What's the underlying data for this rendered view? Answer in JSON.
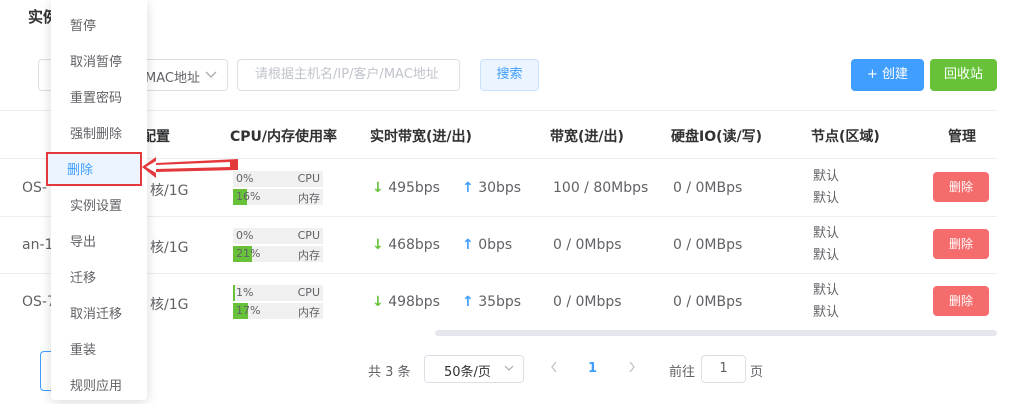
{
  "page": {
    "title_fragment": "实例"
  },
  "filters": {
    "mac_select": "MAC地址",
    "search_placeholder": "请根据主机名/IP/客户/MAC地址",
    "search_button": "搜索"
  },
  "actions": {
    "create": "创建",
    "create_icon": "+",
    "recycle_bin": "回收站"
  },
  "table": {
    "headers": {
      "config": "配置",
      "cpu_mem": "CPU/内存使用率",
      "realtime_bw": "实时带宽(进/出)",
      "bandwidth": "带宽(进/出)",
      "disk_io": "硬盘IO(读/写)",
      "node": "节点(区域)",
      "manage": "管理"
    },
    "rows": [
      {
        "name_fragment": "OS-",
        "config": "核/1G",
        "cpu_pct": "0%",
        "cpu_value": 0,
        "mem_pct": "16%",
        "mem_value": 16,
        "cpu_label": "CPU",
        "mem_label": "内存",
        "in": "495bps",
        "out": "30bps",
        "bandwidth": "100 / 80Mbps",
        "disk_io": "0 / 0MBps",
        "node1": "默认",
        "node2": "默认",
        "delete": "删除"
      },
      {
        "name_fragment": "an-1",
        "config": "核/1G",
        "cpu_pct": "0%",
        "cpu_value": 0,
        "mem_pct": "21%",
        "mem_value": 21,
        "cpu_label": "CPU",
        "mem_label": "内存",
        "in": "468bps",
        "out": "0bps",
        "bandwidth": "0 / 0Mbps",
        "disk_io": "0 / 0MBps",
        "node1": "默认",
        "node2": "默认",
        "delete": "删除"
      },
      {
        "name_fragment": "OS-7",
        "config": "核/1G",
        "cpu_pct": "1%",
        "cpu_value": 1,
        "mem_pct": "17%",
        "mem_value": 17,
        "cpu_label": "CPU",
        "mem_label": "内存",
        "in": "498bps",
        "out": "35bps",
        "bandwidth": "0 / 0Mbps",
        "disk_io": "0 / 0MBps",
        "node1": "默认",
        "node2": "默认",
        "delete": "删除"
      }
    ]
  },
  "pagination": {
    "total": "共 3 条",
    "page_size": "50条/页",
    "current_page": "1",
    "goto_label": "前往",
    "goto_value": "1",
    "page_suffix": "页"
  },
  "dropdown_menu": {
    "items": [
      "暂停",
      "取消暂停",
      "重置密码",
      "强制删除",
      "删除",
      "实例设置",
      "导出",
      "迁移",
      "取消迁移",
      "重装",
      "规则应用"
    ],
    "active_index": 4
  },
  "colors": {
    "primary": "#409eff",
    "success": "#67c23a",
    "danger": "#f56c6c",
    "annotation": "#e4393c"
  }
}
